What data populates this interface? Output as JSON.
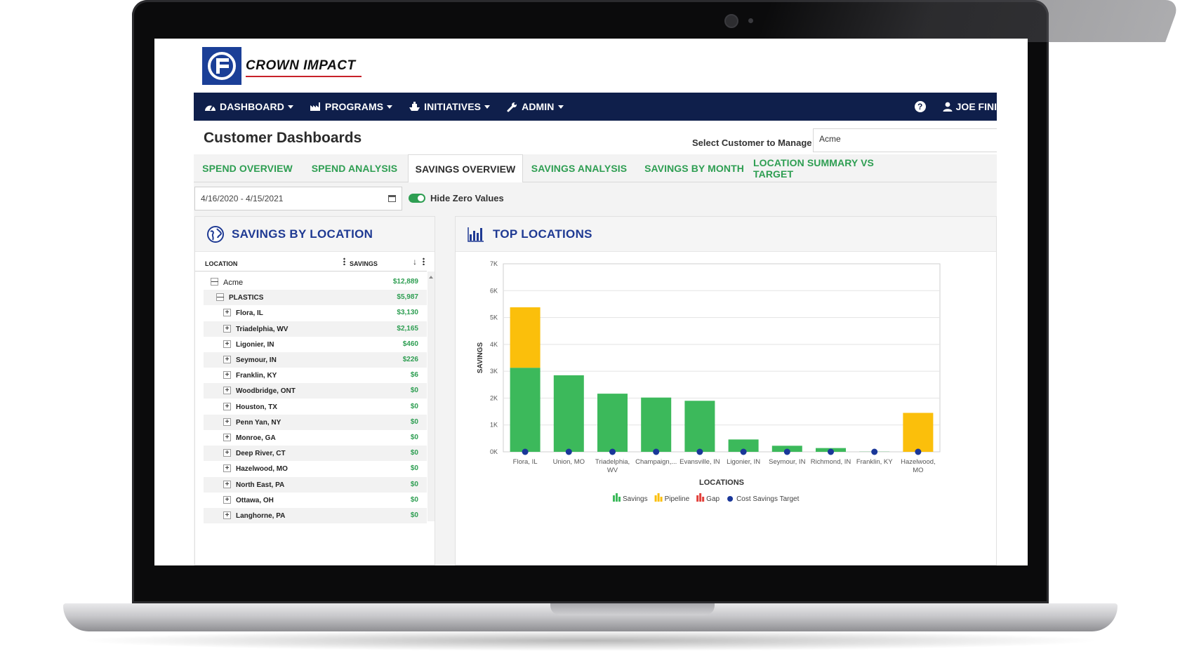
{
  "brand": {
    "name": "CROWN IMPACT"
  },
  "nav": {
    "items": [
      {
        "label": "DASHBOARD",
        "icon": "tachometer-icon"
      },
      {
        "label": "PROGRAMS",
        "icon": "factory-icon"
      },
      {
        "label": "INITIATIVES",
        "icon": "ship-icon"
      },
      {
        "label": "ADMIN",
        "icon": "wrench-icon"
      }
    ],
    "help_icon": "?",
    "user_name": "JOE FINI"
  },
  "page": {
    "title": "Customer Dashboards",
    "customer_label": "Select Customer to Manage",
    "customer_value": "Acme"
  },
  "tabs": [
    {
      "label": "SPEND OVERVIEW",
      "active": false
    },
    {
      "label": "SPEND ANALYSIS",
      "active": false
    },
    {
      "label": "SAVINGS OVERVIEW",
      "active": true
    },
    {
      "label": "SAVINGS ANALYSIS",
      "active": false
    },
    {
      "label": "SAVINGS BY MONTH",
      "active": false
    },
    {
      "label": "LOCATION SUMMARY VS TARGET",
      "active": false
    }
  ],
  "filters": {
    "date_range": "4/16/2020 - 4/15/2021",
    "hide_zero_label": "Hide Zero Values",
    "hide_zero_on": true
  },
  "savings_by_location": {
    "title": "SAVINGS BY LOCATION",
    "col_location": "LOCATION",
    "col_savings": "SAVINGS",
    "rows": [
      {
        "label": "Acme",
        "value": "$12,889",
        "level": 0,
        "expander": "—"
      },
      {
        "label": "PLASTICS",
        "value": "$5,987",
        "level": 1,
        "expander": "—"
      },
      {
        "label": "Flora, IL",
        "value": "$3,130",
        "level": 2,
        "expander": "+"
      },
      {
        "label": "Triadelphia, WV",
        "value": "$2,165",
        "level": 2,
        "expander": "+"
      },
      {
        "label": "Ligonier, IN",
        "value": "$460",
        "level": 2,
        "expander": "+"
      },
      {
        "label": "Seymour, IN",
        "value": "$226",
        "level": 2,
        "expander": "+"
      },
      {
        "label": "Franklin, KY",
        "value": "$6",
        "level": 2,
        "expander": "+"
      },
      {
        "label": "Woodbridge, ONT",
        "value": "$0",
        "level": 2,
        "expander": "+"
      },
      {
        "label": "Houston, TX",
        "value": "$0",
        "level": 2,
        "expander": "+"
      },
      {
        "label": "Penn Yan, NY",
        "value": "$0",
        "level": 2,
        "expander": "+"
      },
      {
        "label": "Monroe, GA",
        "value": "$0",
        "level": 2,
        "expander": "+"
      },
      {
        "label": "Deep River, CT",
        "value": "$0",
        "level": 2,
        "expander": "+"
      },
      {
        "label": "Hazelwood, MO",
        "value": "$0",
        "level": 2,
        "expander": "+"
      },
      {
        "label": "North East, PA",
        "value": "$0",
        "level": 2,
        "expander": "+"
      },
      {
        "label": "Ottawa, OH",
        "value": "$0",
        "level": 2,
        "expander": "+"
      },
      {
        "label": "Langhorne, PA",
        "value": "$0",
        "level": 2,
        "expander": "+"
      }
    ]
  },
  "top_locations": {
    "title": "TOP LOCATIONS"
  },
  "chart_data": {
    "type": "bar",
    "stacked": true,
    "title": "TOP LOCATIONS",
    "xlabel": "LOCATIONS",
    "ylabel": "SAVINGS",
    "ylim": [
      0,
      7000
    ],
    "yticks": [
      "0K",
      "1K",
      "2K",
      "3K",
      "4K",
      "5K",
      "6K",
      "7K"
    ],
    "categories": [
      [
        "Flora, IL"
      ],
      [
        "Union, MO"
      ],
      [
        "Triadelphia,",
        "WV"
      ],
      [
        "Champaign,..."
      ],
      [
        "Evansville, IN"
      ],
      [
        "Ligonier, IN"
      ],
      [
        "Seymour, IN"
      ],
      [
        "Richmond, IN"
      ],
      [
        "Franklin, KY"
      ],
      [
        "Hazelwood,",
        "MO"
      ]
    ],
    "series": [
      {
        "name": "Savings",
        "color": "#3cb95b",
        "values": [
          3130,
          2850,
          2165,
          2020,
          1900,
          460,
          226,
          140,
          6,
          0
        ]
      },
      {
        "name": "Pipeline",
        "color": "#fbbf0b",
        "values": [
          2250,
          0,
          0,
          0,
          0,
          0,
          0,
          0,
          0,
          1450
        ]
      },
      {
        "name": "Gap",
        "color": "#e2403a",
        "values": [
          0,
          0,
          0,
          0,
          0,
          0,
          0,
          0,
          0,
          0
        ]
      },
      {
        "name": "Cost Savings Target",
        "color": "#1a3799",
        "marker": "dot",
        "values": [
          0,
          0,
          0,
          0,
          0,
          0,
          0,
          0,
          0,
          0
        ]
      }
    ],
    "grid": true,
    "legend": "bottom"
  }
}
